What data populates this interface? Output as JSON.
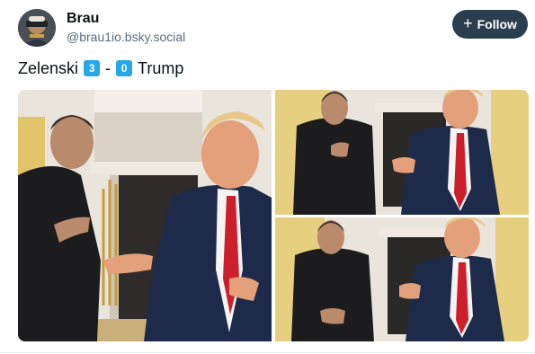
{
  "author": {
    "name": "Brau",
    "handle": "@brau1io.bsky.social"
  },
  "follow_button": {
    "label": "Follow",
    "icon": "plus-icon"
  },
  "post_text": {
    "left_name": "Zelenski",
    "left_score": "3",
    "separator": "-",
    "right_score": "0",
    "right_name": "Trump"
  },
  "images": [
    {
      "id": "main",
      "icon": "photo"
    },
    {
      "id": "top-right",
      "icon": "photo"
    },
    {
      "id": "bottom-right",
      "icon": "photo"
    }
  ],
  "colors": {
    "follow_bg": "#2b3e50",
    "keycap_badge": "#27a7e7",
    "handle_text": "#5b6b7c"
  }
}
